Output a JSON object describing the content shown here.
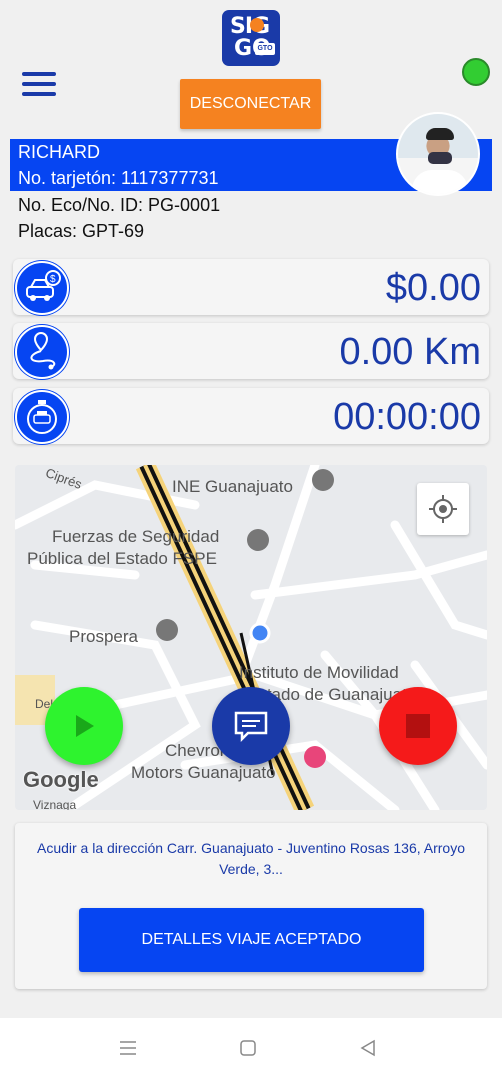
{
  "header": {
    "logo_text_top": "SIG",
    "logo_text_bottom": "GO",
    "logo_badge": "GTO",
    "disconnect_label": "DESCONECTAR",
    "status_color": "#32cd32"
  },
  "driver": {
    "name": "RICHARD",
    "card": "No. tarjetón: 1117377731",
    "eco_id": "No. Eco/No. ID: PG-0001",
    "plates": "Placas: GPT-69"
  },
  "metrics": {
    "fare": "$0.00",
    "distance": "0.00 Km",
    "time": "00:00:00"
  },
  "map": {
    "labels": [
      "Ciprés",
      "INE Guanajuato",
      "Fuerzas de Seguridad",
      "Pública del Estado FSPE",
      "Prospera",
      "Instituto de Movilidad",
      "Estado de Guanajuato",
      "Chevrolet",
      "Motors Guanajuato",
      "Del",
      "Viznaga"
    ],
    "attribution": "Google"
  },
  "trip": {
    "destination": "Acudir a la dirección Carr. Guanajuato - Juventino Rosas 136, Arroyo Verde, 3...",
    "details_label": "DETALLES VIAJE ACEPTADO"
  },
  "colors": {
    "primary": "#0645f2",
    "brand_dark": "#1a3aa8",
    "accent": "#f58220",
    "play": "#2ef32e",
    "stop": "#f51a1a"
  }
}
